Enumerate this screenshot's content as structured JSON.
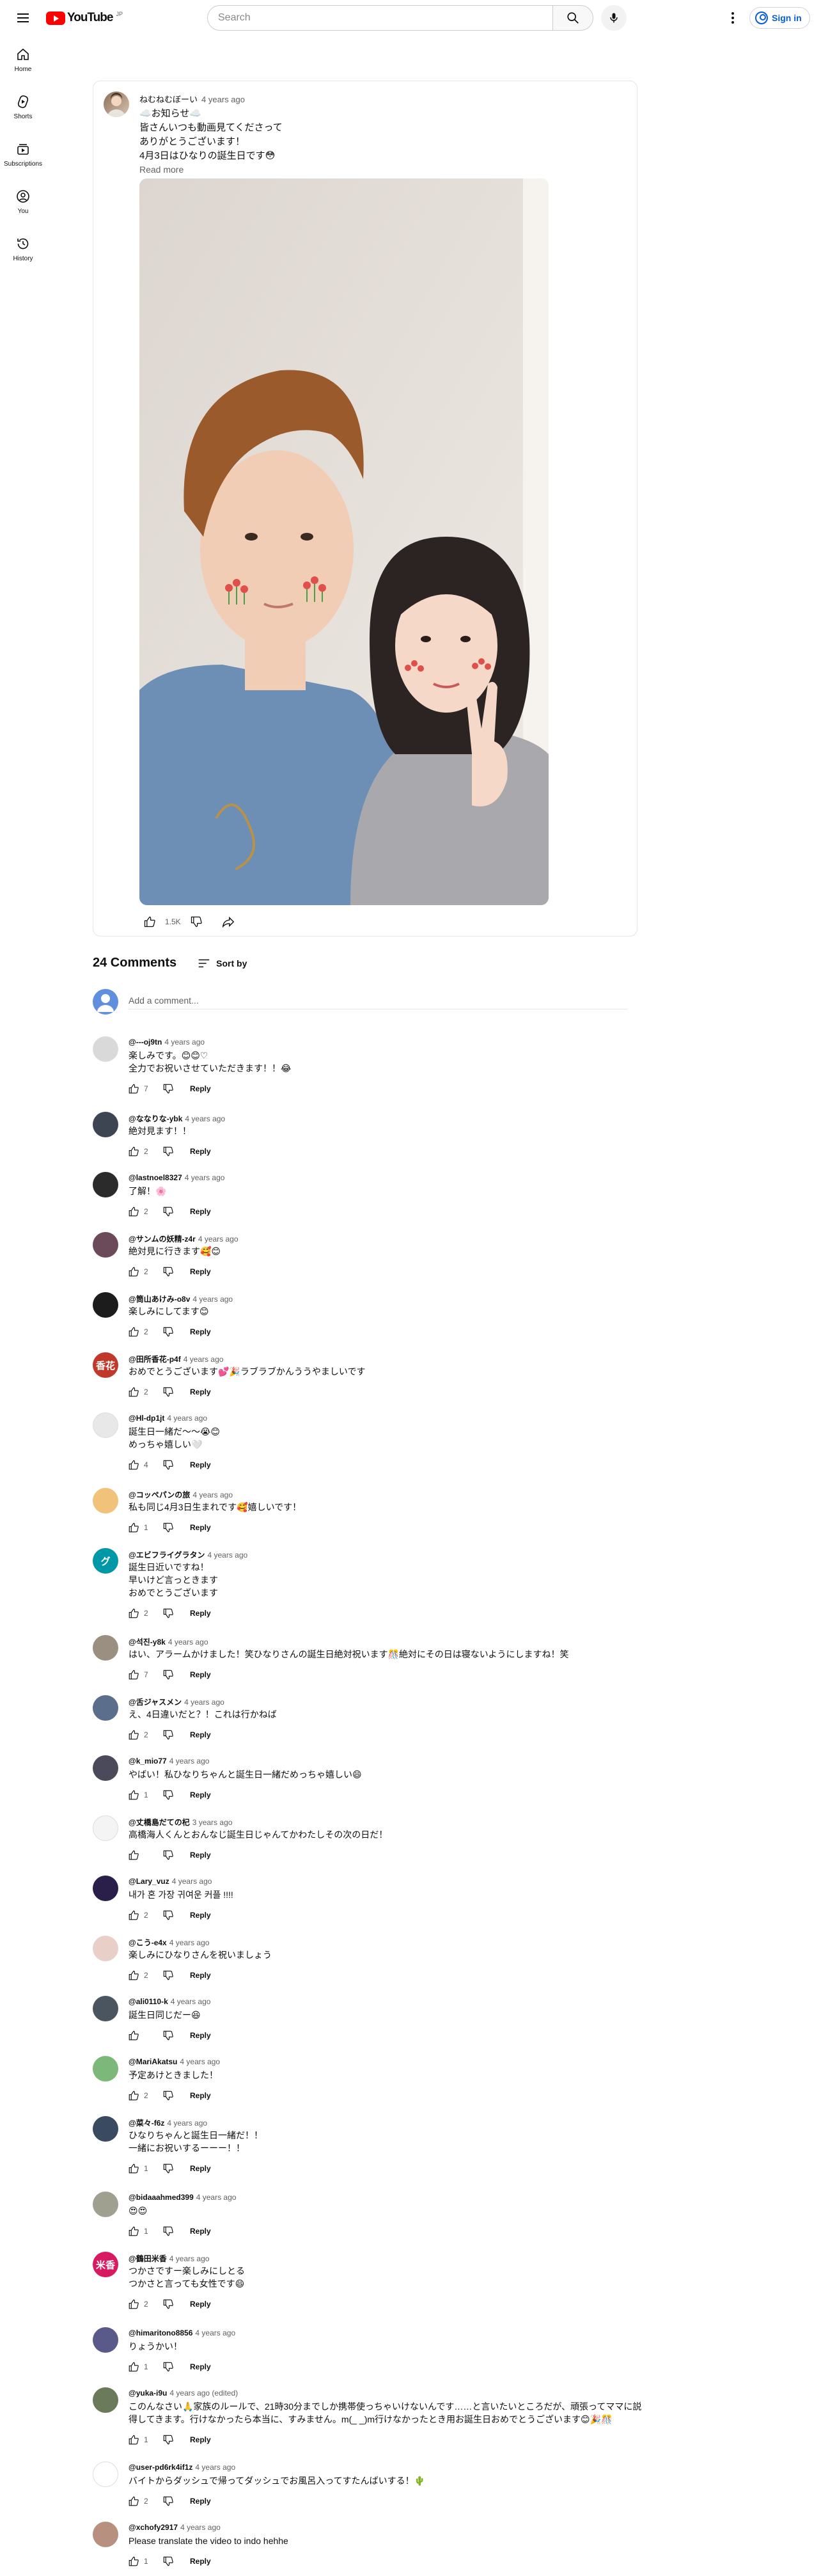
{
  "header": {
    "logo_text": "YouTube",
    "logo_country": "JP",
    "search_placeholder": "Search",
    "signin_label": "Sign in"
  },
  "sidebar": {
    "items": [
      {
        "label": "Home",
        "icon": "home-icon"
      },
      {
        "label": "Shorts",
        "icon": "shorts-icon"
      },
      {
        "label": "Subscriptions",
        "icon": "subscriptions-icon"
      },
      {
        "label": "You",
        "icon": "you-icon"
      },
      {
        "label": "History",
        "icon": "history-icon"
      }
    ]
  },
  "post": {
    "author": "ねむねむぼーい",
    "time": "4 years ago",
    "text": "☁️お知らせ☁️\n皆さんいつも動画見てくださって\nありがとうございます！\n4月3日はひなりの誕生日です😳",
    "read_more": "Read more",
    "likes": "1.5K"
  },
  "comments_section": {
    "count_label": "24 Comments",
    "sort_label": "Sort by",
    "add_placeholder": "Add a comment...",
    "reply_label": "Reply"
  },
  "comments": [
    {
      "author": "@---oj9tn",
      "time": "4 years ago",
      "text": "楽しみです。😊😊♡\n全力でお祝いさせていただきます！！😂",
      "likes": "7",
      "avatar_color": "#d9d9d9",
      "avatar_text": ""
    },
    {
      "author": "@ななりな-ybk",
      "time": "4 years ago",
      "text": "絶対見ます！！",
      "likes": "2",
      "avatar_color": "#3d4552",
      "avatar_text": ""
    },
    {
      "author": "@lastnoel8327",
      "time": "4 years ago",
      "text": "了解！🌸",
      "likes": "2",
      "avatar_color": "#2b2b2b",
      "avatar_text": ""
    },
    {
      "author": "@サンムの妖精-z4r",
      "time": "4 years ago",
      "text": "絶対見に行きます🥰😊",
      "likes": "2",
      "avatar_color": "#6b4a5a",
      "avatar_text": ""
    },
    {
      "author": "@筒山あけみ-o8v",
      "time": "4 years ago",
      "text": "楽しみにしてます😊",
      "likes": "2",
      "avatar_color": "#1c1c1c",
      "avatar_text": ""
    },
    {
      "author": "@田所香花-p4f",
      "time": "4 years ago",
      "text": "おめでとうございます💕🎉ラブラブかんううやましいです",
      "likes": "2",
      "avatar_color": "#c0392b",
      "avatar_text": "香花"
    },
    {
      "author": "@Hl-dp1jt",
      "time": "4 years ago",
      "text": "誕生日一緒だ〜〜😭😊\nめっちゃ嬉しい🤍",
      "likes": "4",
      "avatar_color": "#e8e8e8",
      "avatar_text": ""
    },
    {
      "author": "@コッペパンの旅",
      "time": "4 years ago",
      "text": "私も同じ4月3日生まれです🥰嬉しいです！",
      "likes": "1",
      "avatar_color": "#f0c27a",
      "avatar_text": ""
    },
    {
      "author": "@エビフライグラタン",
      "time": "4 years ago",
      "text": "誕生日近いですね！\n早いけど言っときます\nおめでとうございます",
      "likes": "2",
      "avatar_color": "#0097a7",
      "avatar_text": "グ"
    },
    {
      "author": "@석진-y8k",
      "time": "4 years ago",
      "text": "はい、アラームかけました！笑ひなりさんの誕生日絶対祝います🎊絶対にその日は寝ないようにしますね！笑",
      "likes": "7",
      "avatar_color": "#9a8f80",
      "avatar_text": ""
    },
    {
      "author": "@舌ジャスメン",
      "time": "4 years ago",
      "text": "え、4日違いだと？！これは行かねば",
      "likes": "2",
      "avatar_color": "#5b6e8c",
      "avatar_text": ""
    },
    {
      "author": "@k_mio77",
      "time": "4 years ago",
      "text": "やばい！私ひなりちゃんと誕生日一緒だめっちゃ嬉しい😄",
      "likes": "1",
      "avatar_color": "#4a4a5a",
      "avatar_text": ""
    },
    {
      "author": "@丈橋島だての杞",
      "time": "3 years ago",
      "text": "高橋海人くんとおんなじ誕生日じゃんてかわたしその次の日だ！",
      "likes": "",
      "avatar_color": "#f4f4f4",
      "avatar_text": ""
    },
    {
      "author": "@Lary_vuz",
      "time": "4 years ago",
      "text": "내가 혼 가장 귀여운 커플 !!!!",
      "likes": "2",
      "avatar_color": "#2a1f4a",
      "avatar_text": ""
    },
    {
      "author": "@こう-e4x",
      "time": "4 years ago",
      "text": "楽しみにひなりさんを祝いましょう",
      "likes": "2",
      "avatar_color": "#e8d0c8",
      "avatar_text": ""
    },
    {
      "author": "@ali0110-k",
      "time": "4 years ago",
      "text": "誕生日同じだー😆",
      "likes": "",
      "avatar_color": "#4a5560",
      "avatar_text": ""
    },
    {
      "author": "@MariAkatsu",
      "time": "4 years ago",
      "text": "予定あけときました！",
      "likes": "2",
      "avatar_color": "#7cb87a",
      "avatar_text": ""
    },
    {
      "author": "@菜々-f6z",
      "time": "4 years ago",
      "text": "ひなりちゃんと誕生日一緒だ！！\n一緒にお祝いするーーー！！",
      "likes": "1",
      "avatar_color": "#3a4a60",
      "avatar_text": ""
    },
    {
      "author": "@bidaaahmed399",
      "time": "4 years ago",
      "text": "😍😍",
      "likes": "1",
      "avatar_color": "#a0a090",
      "avatar_text": ""
    },
    {
      "author": "@鶴田米香",
      "time": "4 years ago",
      "text": "つかさですー楽しみにしとる\nつかさと言っても女性です😄",
      "likes": "2",
      "avatar_color": "#d81b60",
      "avatar_text": "米香"
    },
    {
      "author": "@himaritono8856",
      "time": "4 years ago",
      "text": "りょうかい！",
      "likes": "1",
      "avatar_color": "#5a5a8a",
      "avatar_text": ""
    },
    {
      "author": "@yuka-i9u",
      "time": "4 years ago (edited)",
      "text": "このんなさい🙏家族のルールで、21時30分までしか携帯使っちゃいけないんです……と言いたいところだが、頑張ってママに説得してきます。行けなかったら本当に、すみません。m(_ _)m行けなかったとき用お誕生日おめでとうございます😊🎉🎊",
      "likes": "1",
      "avatar_color": "#6a7a5a",
      "avatar_text": ""
    },
    {
      "author": "@user-pd6rk4if1z",
      "time": "4 years ago",
      "text": "バイトからダッシュで帰ってダッシュでお風呂入ってすたんばいする！🌵",
      "likes": "2",
      "avatar_color": "#ffffff",
      "avatar_text": ""
    },
    {
      "author": "@xchofy2917",
      "time": "4 years ago",
      "text": "Please translate the video to indo hehhe",
      "likes": "1",
      "avatar_color": "#b89080",
      "avatar_text": ""
    }
  ],
  "colors": {
    "accent": "#065fd4",
    "brand": "#ff0000",
    "text": "#0f0f0f",
    "secondary": "#606060"
  }
}
